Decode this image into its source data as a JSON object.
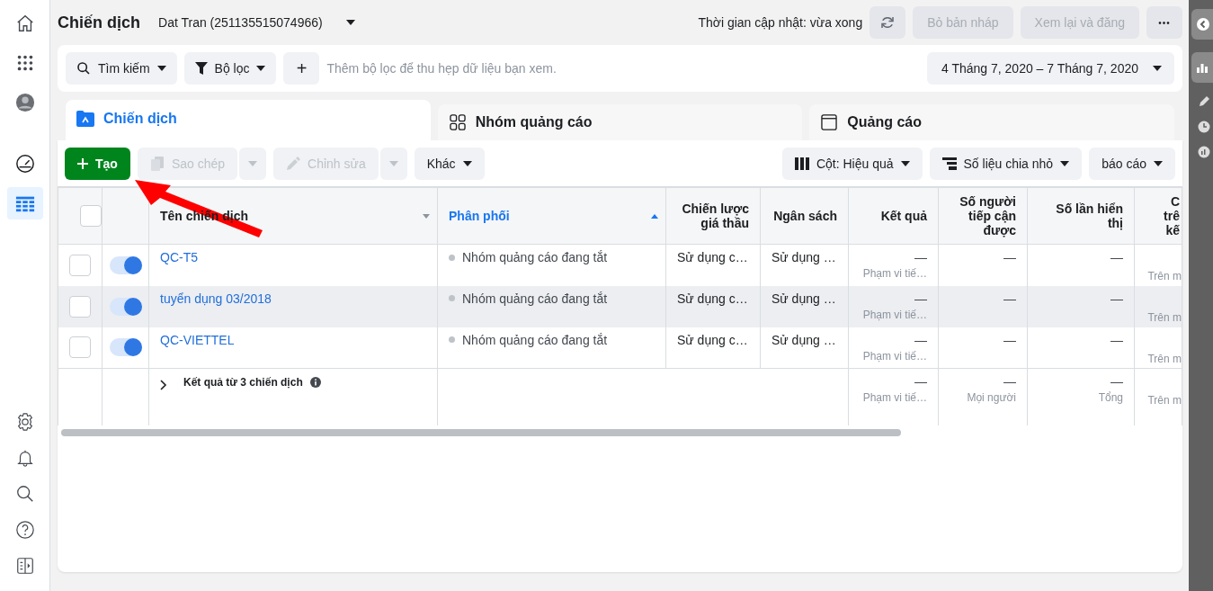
{
  "sidebar": {
    "top_items": [
      {
        "selected": false
      },
      {
        "selected": false
      },
      {
        "selected": false
      },
      {
        "selected": false
      },
      {
        "selected": true
      }
    ],
    "bottom_items": [
      {
        "selected": false
      },
      {
        "selected": false
      },
      {
        "selected": false
      },
      {
        "selected": false
      },
      {
        "selected": false
      }
    ]
  },
  "header": {
    "title": "Chiến dịch",
    "account": "Dat Tran (251135515074966)",
    "update_text": "Thời gian cập nhật: vừa xong",
    "buttons": [
      {
        "label": "Bỏ bản nháp",
        "disabled": true
      },
      {
        "label": "Xem lại và đăng",
        "disabled": true
      }
    ],
    "more": "•••"
  },
  "filter_bar": {
    "search": "Tìm kiếm",
    "filter": "Bộ lọc",
    "add": "+",
    "hint": "Thêm bộ lọc để thu hẹp dữ liệu bạn xem.",
    "date_range": "4 Tháng 7, 2020 – 7 Tháng 7, 2020"
  },
  "tabs": [
    {
      "label": "Chiến dịch",
      "selected": true
    },
    {
      "label": "Nhóm quảng cáo",
      "selected": false
    },
    {
      "label": "Quảng cáo",
      "selected": false
    }
  ],
  "toolbar": {
    "create": {
      "label": "Tạo",
      "disabled": false
    },
    "copy": {
      "label": "Sao chép",
      "disabled": true
    },
    "edit": {
      "label": "Chỉnh sửa",
      "disabled": true
    },
    "more": "Khác",
    "columns": "Cột: Hiệu quả",
    "breakdown": "Số liệu chia nhỏ",
    "reports": "báo cáo"
  },
  "table": {
    "header_checked": false,
    "columns": [
      {
        "label": "Tên chiến dịch",
        "sort_ascending": false,
        "selected": false
      },
      {
        "label": "Phân phối",
        "sort_ascending": true,
        "selected": true
      },
      {
        "label": "Chiến lược giá thầu"
      },
      {
        "label": "Ngân sách"
      },
      {
        "label": "Kết quả"
      },
      {
        "label": "Số người tiếp cận được"
      },
      {
        "label": "Số lần hiển thị"
      },
      {
        "label": "C trê kế"
      }
    ],
    "rows": [
      {
        "checked": false,
        "on": true,
        "hovered": false,
        "name": "QC-T5",
        "delivery": "Nhóm quảng cáo đang tắt",
        "bid_strategy": "Sử dụng c…",
        "budget": "Sử dụng …",
        "result": "—",
        "result_note": "Phạm vi tiế…",
        "reach": "—",
        "impressions": "—",
        "column_8_note": "Trên m"
      },
      {
        "checked": false,
        "on": true,
        "hovered": true,
        "name": "tuyển dụng 03/2018",
        "delivery": "Nhóm quảng cáo đang tắt",
        "bid_strategy": "Sử dụng c…",
        "budget": "Sử dụng …",
        "result": "—",
        "result_note": "Phạm vi tiế…",
        "reach": "—",
        "impressions": "—",
        "column_8_note": "Trên m"
      },
      {
        "checked": false,
        "on": true,
        "hovered": false,
        "name": "QC-VIETTEL",
        "delivery": "Nhóm quảng cáo đang tắt",
        "bid_strategy": "Sử dụng c…",
        "budget": "Sử dụng …",
        "result": "—",
        "result_note": "Phạm vi tiế…",
        "reach": "—",
        "impressions": "—",
        "column_8_note": "Trên m"
      }
    ],
    "footer": {
      "label": "Kết quả từ 3 chiến dịch",
      "result": "—",
      "result_note": "Phạm vi tiế…",
      "reach": "—",
      "reach_note": "Mọi người",
      "impressions": "—",
      "impressions_note": "Tổng",
      "column_8_note": "Trên m"
    }
  }
}
